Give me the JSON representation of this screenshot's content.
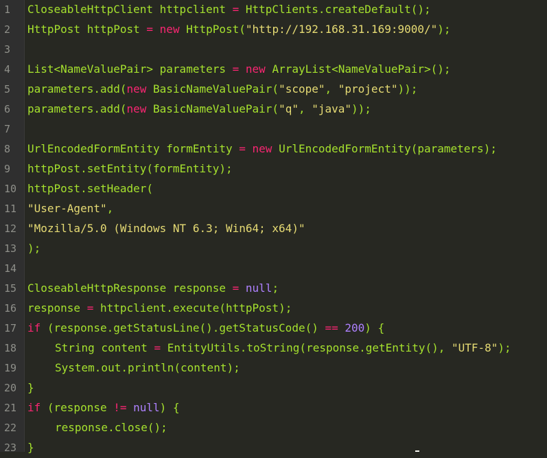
{
  "editor": {
    "colors": {
      "background": "#272822",
      "gutter": "#2f2f2f",
      "identifier": "#a6e22e",
      "keyword": "#f92672",
      "string": "#e6db74",
      "number": "#ae81ff",
      "plain": "#f8f8f2",
      "line_number": "#8f908a"
    },
    "lines": [
      {
        "n": "1",
        "tokens": [
          {
            "t": "CloseableHttpClient httpclient ",
            "c": "tx"
          },
          {
            "t": "=",
            "c": "kw"
          },
          {
            "t": " HttpClients.createDefault();",
            "c": "tx"
          }
        ]
      },
      {
        "n": "2",
        "tokens": [
          {
            "t": "HttpPost httpPost ",
            "c": "tx"
          },
          {
            "t": "=",
            "c": "kw"
          },
          {
            "t": " ",
            "c": "tx"
          },
          {
            "t": "new",
            "c": "kw"
          },
          {
            "t": " HttpPost(",
            "c": "tx"
          },
          {
            "t": "\"http://192.168.31.169:9000/\"",
            "c": "st"
          },
          {
            "t": ");",
            "c": "tx"
          }
        ]
      },
      {
        "n": "3",
        "tokens": []
      },
      {
        "n": "4",
        "tokens": [
          {
            "t": "List<NameValuePair> parameters ",
            "c": "tx"
          },
          {
            "t": "=",
            "c": "kw"
          },
          {
            "t": " ",
            "c": "tx"
          },
          {
            "t": "new",
            "c": "kw"
          },
          {
            "t": " ArrayList<NameValuePair>();",
            "c": "tx"
          }
        ]
      },
      {
        "n": "5",
        "tokens": [
          {
            "t": "parameters.add(",
            "c": "tx"
          },
          {
            "t": "new",
            "c": "kw"
          },
          {
            "t": " BasicNameValuePair(",
            "c": "tx"
          },
          {
            "t": "\"scope\"",
            "c": "st"
          },
          {
            "t": ", ",
            "c": "tx"
          },
          {
            "t": "\"project\"",
            "c": "st"
          },
          {
            "t": "));",
            "c": "tx"
          }
        ]
      },
      {
        "n": "6",
        "tokens": [
          {
            "t": "parameters.add(",
            "c": "tx"
          },
          {
            "t": "new",
            "c": "kw"
          },
          {
            "t": " BasicNameValuePair(",
            "c": "tx"
          },
          {
            "t": "\"q\"",
            "c": "st"
          },
          {
            "t": ", ",
            "c": "tx"
          },
          {
            "t": "\"java\"",
            "c": "st"
          },
          {
            "t": "));",
            "c": "tx"
          }
        ]
      },
      {
        "n": "7",
        "tokens": []
      },
      {
        "n": "8",
        "tokens": [
          {
            "t": "UrlEncodedFormEntity formEntity ",
            "c": "tx"
          },
          {
            "t": "=",
            "c": "kw"
          },
          {
            "t": " ",
            "c": "tx"
          },
          {
            "t": "new",
            "c": "kw"
          },
          {
            "t": " UrlEncodedFormEntity(parameters);",
            "c": "tx"
          }
        ]
      },
      {
        "n": "9",
        "tokens": [
          {
            "t": "httpPost.setEntity(formEntity);",
            "c": "tx"
          }
        ]
      },
      {
        "n": "10",
        "tokens": [
          {
            "t": "httpPost.setHeader(",
            "c": "tx"
          }
        ]
      },
      {
        "n": "11",
        "tokens": [
          {
            "t": "\"User-Agent\"",
            "c": "st"
          },
          {
            "t": ",",
            "c": "tx"
          }
        ]
      },
      {
        "n": "12",
        "tokens": [
          {
            "t": "\"Mozilla/5.0 (Windows NT 6.3; Win64; x64)\"",
            "c": "st"
          }
        ]
      },
      {
        "n": "13",
        "tokens": [
          {
            "t": ");",
            "c": "tx"
          }
        ]
      },
      {
        "n": "14",
        "tokens": []
      },
      {
        "n": "15",
        "tokens": [
          {
            "t": "CloseableHttpResponse response ",
            "c": "tx"
          },
          {
            "t": "=",
            "c": "kw"
          },
          {
            "t": " ",
            "c": "tx"
          },
          {
            "t": "null",
            "c": "nu"
          },
          {
            "t": ";",
            "c": "tx"
          }
        ]
      },
      {
        "n": "16",
        "tokens": [
          {
            "t": "response ",
            "c": "tx"
          },
          {
            "t": "=",
            "c": "kw"
          },
          {
            "t": " httpclient.execute(httpPost);",
            "c": "tx"
          }
        ]
      },
      {
        "n": "17",
        "tokens": [
          {
            "t": "if",
            "c": "kw"
          },
          {
            "t": " (response.getStatusLine().getStatusCode() ",
            "c": "tx"
          },
          {
            "t": "==",
            "c": "kw"
          },
          {
            "t": " ",
            "c": "tx"
          },
          {
            "t": "200",
            "c": "nu"
          },
          {
            "t": ") {",
            "c": "tx"
          }
        ]
      },
      {
        "n": "18",
        "indent": 1,
        "tokens": [
          {
            "t": "String content ",
            "c": "tx"
          },
          {
            "t": "=",
            "c": "kw"
          },
          {
            "t": " EntityUtils.toString(response.getEntity(), ",
            "c": "tx"
          },
          {
            "t": "\"UTF-8\"",
            "c": "st"
          },
          {
            "t": ");",
            "c": "tx"
          }
        ]
      },
      {
        "n": "19",
        "indent": 1,
        "tokens": [
          {
            "t": "System.out.println(content);",
            "c": "tx"
          }
        ]
      },
      {
        "n": "20",
        "tokens": [
          {
            "t": "}",
            "c": "tx"
          }
        ]
      },
      {
        "n": "21",
        "tokens": [
          {
            "t": "if",
            "c": "kw"
          },
          {
            "t": " (response ",
            "c": "tx"
          },
          {
            "t": "!=",
            "c": "kw"
          },
          {
            "t": " ",
            "c": "tx"
          },
          {
            "t": "null",
            "c": "nu"
          },
          {
            "t": ") {",
            "c": "tx"
          }
        ]
      },
      {
        "n": "22",
        "indent": 1,
        "tokens": [
          {
            "t": "response.close();",
            "c": "tx"
          }
        ]
      },
      {
        "n": "23",
        "tokens": [
          {
            "t": "}",
            "c": "tx"
          }
        ]
      }
    ]
  }
}
